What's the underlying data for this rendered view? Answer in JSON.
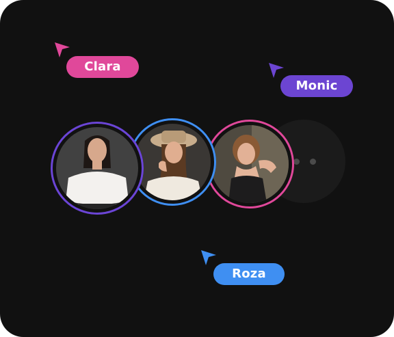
{
  "users": [
    {
      "name": "Clara",
      "color": "#e0489a"
    },
    {
      "name": "Monic",
      "color": "#6c45d2"
    },
    {
      "name": "Roza",
      "color": "#3f8ff2"
    }
  ],
  "avatars": [
    {
      "ring_color": "#6b45d6",
      "icon": "avatar-photo-icon"
    },
    {
      "ring_color": "#3f8ff2",
      "icon": "avatar-photo-icon"
    },
    {
      "ring_color": "#e0489a",
      "icon": "avatar-photo-icon"
    }
  ],
  "more_avatars": {
    "icon": "more-dots-icon"
  }
}
